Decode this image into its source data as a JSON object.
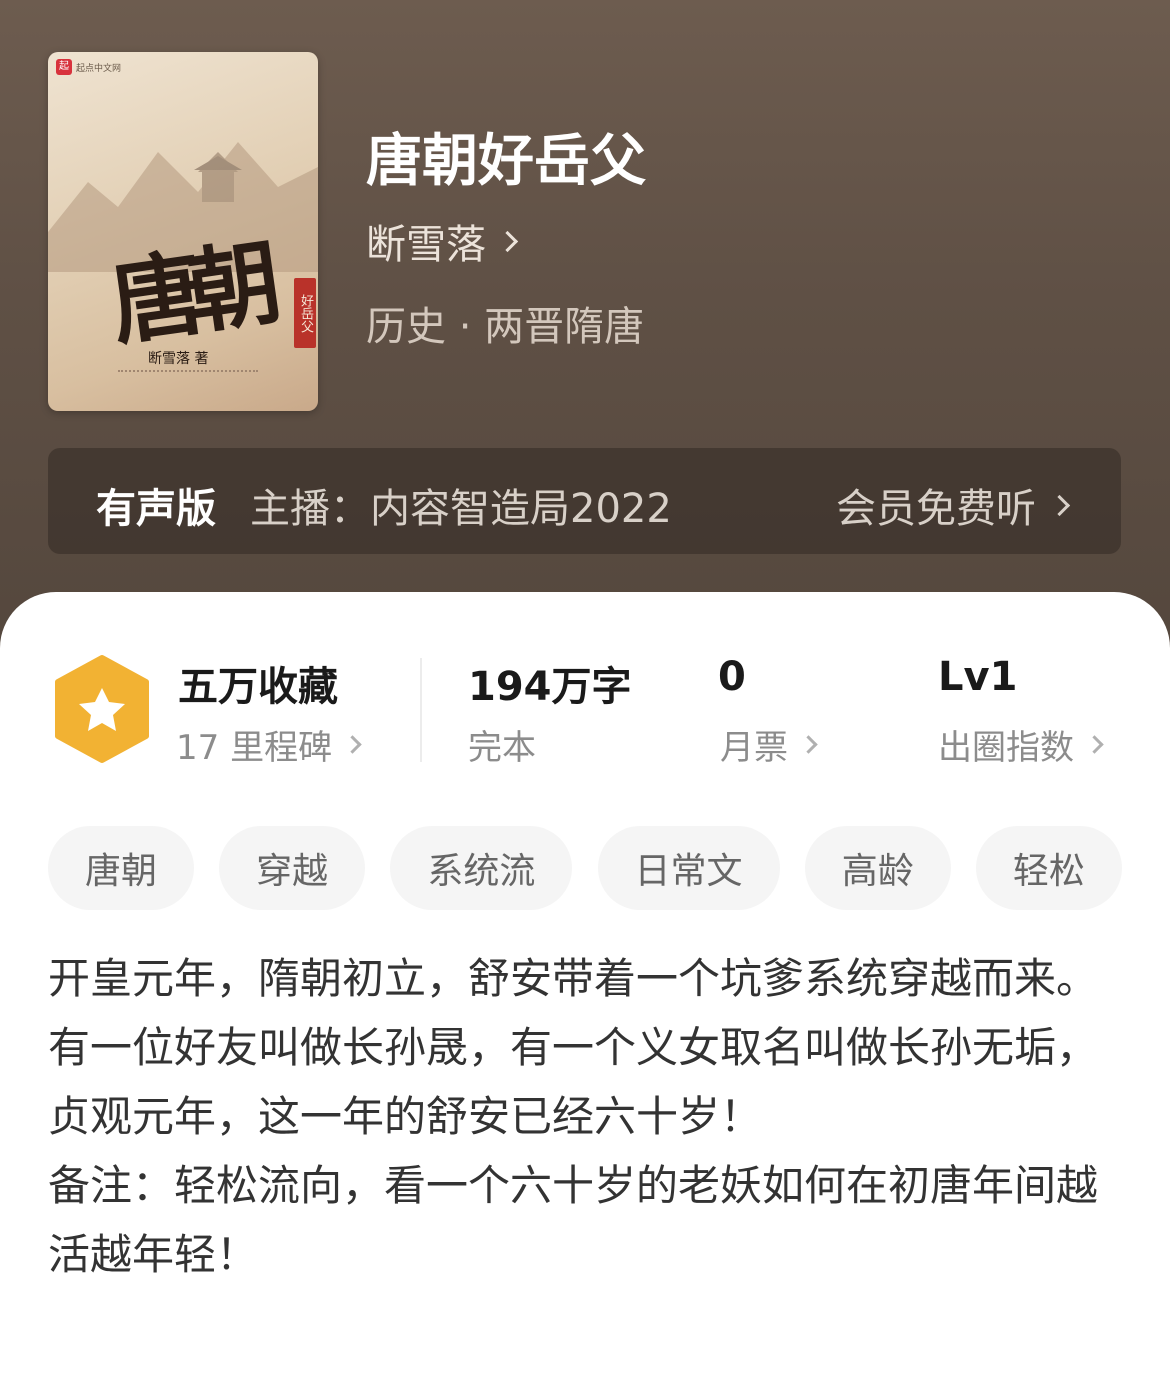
{
  "book": {
    "title": "唐朝好岳父",
    "author": "断雪落",
    "category": "历史 · 两晋隋唐",
    "cover": {
      "publisher": "起点中文网",
      "calligraphy": "唐朝",
      "seal": "好岳父",
      "author_text": "断雪落 著"
    }
  },
  "audio": {
    "label": "有声版",
    "host": "主播：内容智造局2022",
    "cta": "会员免费听"
  },
  "stats": {
    "favorites": {
      "value": "五万收藏",
      "sub": "17 里程碑"
    },
    "words": {
      "value": "194万字",
      "sub": "完本"
    },
    "monthly_tickets": {
      "value": "0",
      "sub": "月票"
    },
    "popularity": {
      "value": "Lv1",
      "sub": "出圈指数"
    }
  },
  "tags": [
    "唐朝",
    "穿越",
    "系统流",
    "日常文",
    "高龄",
    "轻松"
  ],
  "description": [
    "开皇元年，隋朝初立，舒安带着一个坑爹系统穿越而来。",
    "有一位好友叫做长孙晟，有一个义女取名叫做长孙无垢，贞观元年，这一年的舒安已经六十岁！",
    "备注：轻松流向，看一个六十岁的老妖如何在初唐年间越活越年轻！"
  ],
  "colors": {
    "accent_gold": "#f2b233",
    "hero_bg": "#5f5045"
  }
}
